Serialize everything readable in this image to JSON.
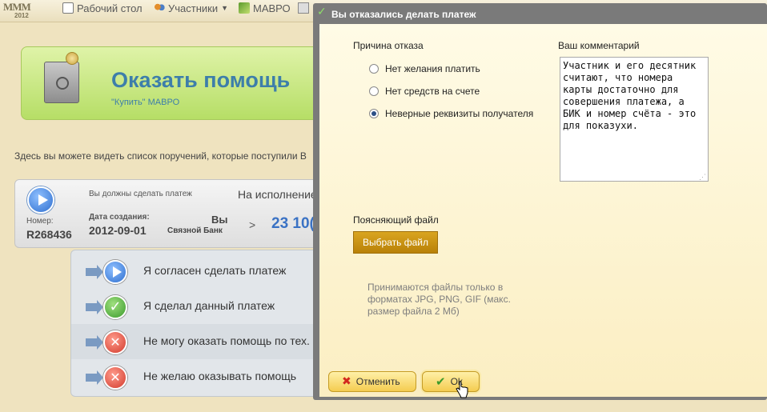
{
  "nav": {
    "logo_year": "2012",
    "items": [
      {
        "label": "Рабочий стол",
        "icon": "desktop-icon"
      },
      {
        "label": "Участники",
        "icon": "users-icon"
      },
      {
        "label": "МАВРО",
        "icon": "mavro-icon"
      }
    ]
  },
  "banner": {
    "title": "Оказать помощь",
    "subtitle": "\"Купить\" МАВРО"
  },
  "intro_text": "Здесь вы можете видеть список поручений, которые поступили В",
  "order": {
    "instruction": "Вы должны сделать платеж",
    "status": "На исполнение",
    "number_label": "Номер:",
    "number": "R268436",
    "created_label": "Дата создания:",
    "created_date": "2012-09-01",
    "payer": "Вы",
    "bank": "Связной Банк",
    "arrow": ">",
    "amount": "23 10("
  },
  "actions": [
    {
      "label": "Я согласен сделать платеж",
      "icon": "play-icon"
    },
    {
      "label": "Я сделал данный платеж",
      "icon": "check-icon"
    },
    {
      "label": "Не могу оказать помощь по тех.",
      "icon": "cross-icon"
    },
    {
      "label": "Не желаю оказывать помощь",
      "icon": "cross-icon"
    }
  ],
  "modal": {
    "title": "Вы отказались делать платеж",
    "reason_title": "Причина отказа",
    "reasons": [
      {
        "label": "Нет желания платить",
        "selected": false
      },
      {
        "label": "Нет средств на счете",
        "selected": false
      },
      {
        "label": "Неверные реквизиты получателя",
        "selected": true
      }
    ],
    "comment_title": "Ваш комментарий",
    "comment_value": "Участник и его десятник считают, что номера карты достаточно для совершения платежа, а БИК и номер счёта - это для показухи.",
    "file_title": "Поясняющий файл",
    "file_button": "Выбрать файл",
    "file_note": "Принимаются файлы только в форматах JPG, PNG, GIF (макс. размер файла 2 Мб)",
    "cancel_button": "Отменить",
    "ok_button": "Ok"
  },
  "colors": {
    "banner_title": "#3d7eaa",
    "amount": "#3a72c4",
    "file_button": "#c8900f",
    "modal_frame": "#7a7a7a"
  }
}
